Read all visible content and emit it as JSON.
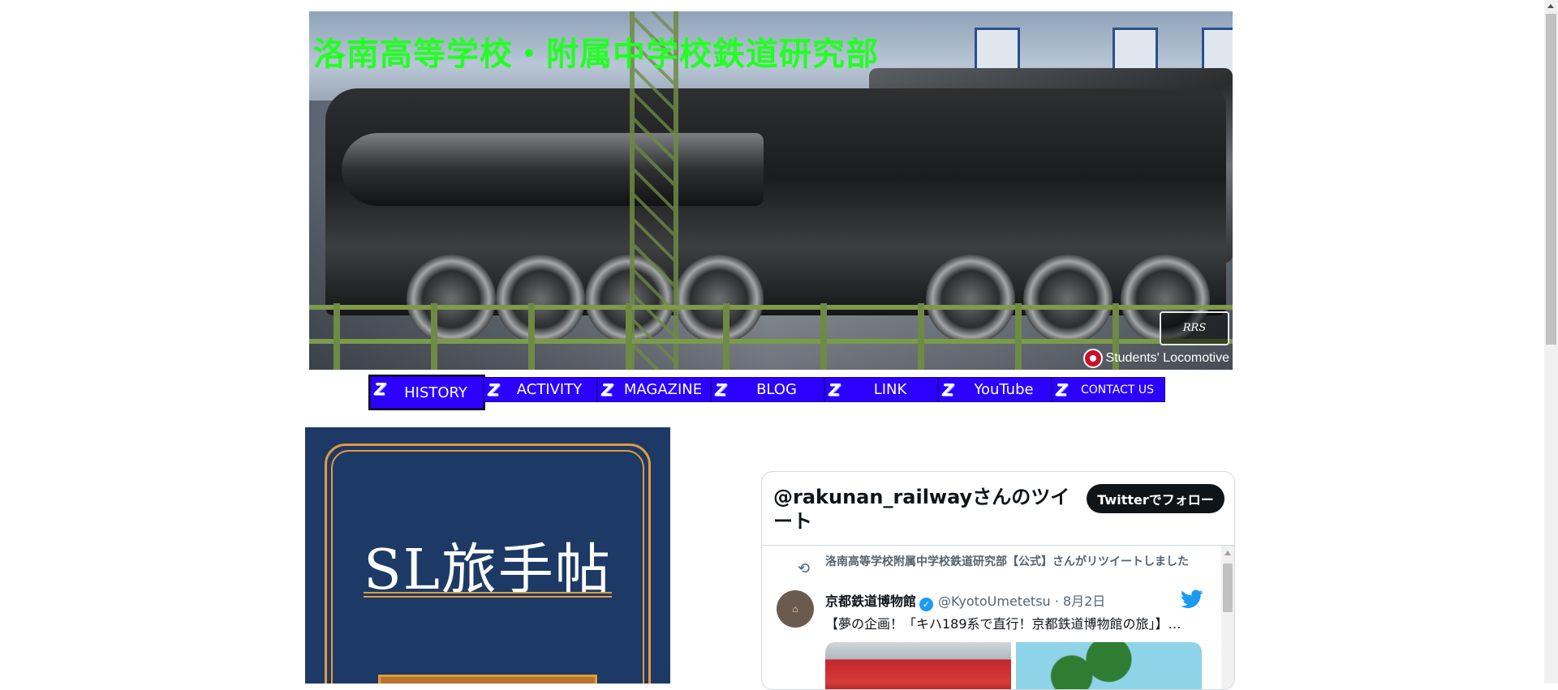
{
  "header": {
    "title": "洛南高等学校・附属中学校鉄道研究部",
    "logo_text": "RRS",
    "badge_text": "Students' Locomotive"
  },
  "nav": {
    "items": [
      {
        "label": "HISTORY",
        "active": true
      },
      {
        "label": "ACTIVITY",
        "active": false
      },
      {
        "label": "MAGAZINE",
        "active": false
      },
      {
        "label": "BLOG",
        "active": false
      },
      {
        "label": "LINK",
        "active": false
      },
      {
        "label": "YouTube",
        "active": false
      },
      {
        "label": "CONTACT US",
        "active": false
      }
    ],
    "colors": {
      "background": "#2b00ff",
      "text": "#ffffff"
    }
  },
  "book": {
    "title": "SL旅手帖",
    "colors": {
      "background": "#1d3a66",
      "accent": "#e39b3d"
    }
  },
  "twitter": {
    "header": "@rakunan_railwayさんのツイート",
    "follow_label": "Twitterでフォロー",
    "retweet_line": "洛南高等学校附属中学校鉄道研究部【公式】さんがリツイートしました",
    "tweet": {
      "name": "京都鉄道博物館",
      "handle": "@KyotoUmetetsu · 8月2日",
      "text": "【夢の企画！「キハ189系で直行！京都鉄道博物館の旅」】…"
    },
    "icons": [
      "retweet-icon",
      "verified-icon",
      "twitter-bird-icon"
    ]
  }
}
